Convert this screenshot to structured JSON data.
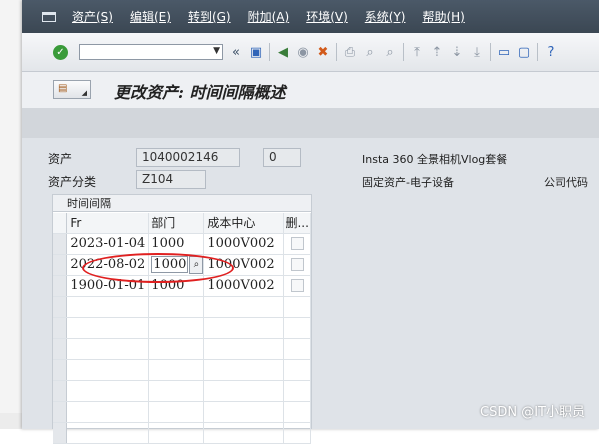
{
  "menubar": {
    "items": [
      "资产(S)",
      "编辑(E)",
      "转到(G)",
      "附加(A)",
      "环境(V)",
      "系统(Y)",
      "帮助(H)"
    ]
  },
  "toolbar": {
    "command_value": "",
    "icons": [
      "enter-check-icon",
      "command-dropdown-icon",
      "back-arrows-icon",
      "save-icon",
      "back-icon",
      "exit-icon",
      "cancel-icon",
      "print-icon",
      "find-icon",
      "find-next-icon",
      "first-page-icon",
      "prev-page-icon",
      "next-page-icon",
      "last-page-icon",
      "new-session-icon",
      "shortcut-icon",
      "help-icon"
    ],
    "glyphs": {
      "back_arrows": "«",
      "save": "▣",
      "back": "◀",
      "exit": "◉",
      "cancel": "✖",
      "print": "⎙",
      "find": "⌕",
      "find_next": "⌕",
      "first_page": "⤒",
      "prev_page": "⇡",
      "next_page": "⇣",
      "last_page": "⤓",
      "new_session": "▭",
      "shortcut": "▢",
      "help": "?"
    }
  },
  "title": {
    "text": "更改资产: 时间间隔概述"
  },
  "header": {
    "asset_label": "资产",
    "asset_number": "1040002146",
    "sub_number": "0",
    "asset_description": "Insta 360 全景相机Vlog套餐",
    "asset_class_label": "资产分类",
    "asset_class": "Z104",
    "asset_class_description": "固定资产-电子设备",
    "company_code_label": "公司代码"
  },
  "group": {
    "title": "时间间隔",
    "columns": [
      "Fr",
      "部门",
      "成本中心",
      "删..."
    ],
    "rows": [
      {
        "from": "2023-01-04",
        "dept": "1000",
        "cost_center": "1000V002"
      },
      {
        "from": "2022-08-02",
        "dept": "1000",
        "cost_center": "1000V002"
      },
      {
        "from": "1900-01-01",
        "dept": "1000",
        "cost_center": "1000V002"
      }
    ]
  },
  "colors": {
    "menubar_bg": "#3b4753",
    "annotation_ellipse": "#e02020"
  },
  "watermark": "CSDN @IT小职员"
}
